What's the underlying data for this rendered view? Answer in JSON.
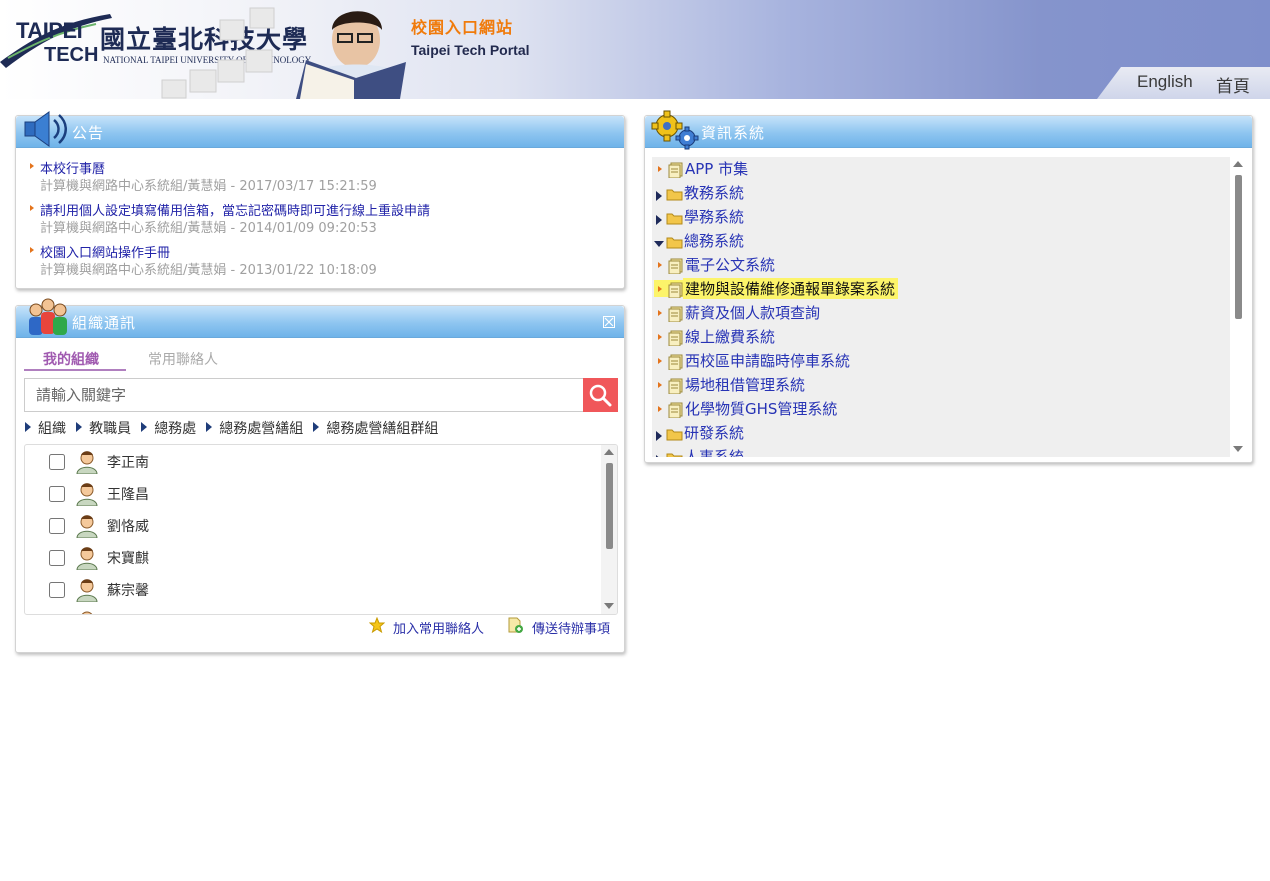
{
  "header": {
    "logo_word_top": "TAIPEI",
    "logo_word_bottom": "TECH",
    "logo_cn": "國立臺北科技大學",
    "logo_en": "NATIONAL TAIPEI UNIVERSITY OF TECHNOLOGY",
    "portal_cn": "校園入口網站",
    "portal_en": "Taipei Tech Portal",
    "nav": {
      "english": "English",
      "home": "首頁"
    }
  },
  "announcements": {
    "title": "公告",
    "items": [
      {
        "title": "本校行事曆",
        "meta": "計算機與網路中心系統組/黃慧娟 - 2017/03/17 15:21:59"
      },
      {
        "title": "請利用個人設定填寫備用信箱，當忘記密碼時即可進行線上重設申請",
        "meta": "計算機與網路中心系統組/黃慧娟 - 2014/01/09 09:20:53"
      },
      {
        "title": "校園入口網站操作手冊",
        "meta": "計算機與網路中心系統組/黃慧娟 - 2013/01/22 10:18:09"
      }
    ]
  },
  "org": {
    "title": "組織通訊",
    "tabs": {
      "mine": "我的組織",
      "common": "常用聯絡人"
    },
    "search_placeholder": "請輸入關鍵字",
    "breadcrumb": [
      "組織",
      "教職員",
      "總務處",
      "總務處營繕組",
      "總務處營繕組群組"
    ],
    "contacts": [
      "李正南",
      "王隆昌",
      "劉恪威",
      "宋寶麒",
      "蘇宗馨"
    ],
    "actions": {
      "add_common": "加入常用聯絡人",
      "send_todo": "傳送待辦事項"
    }
  },
  "systems": {
    "title": "資訊系統",
    "nodes": [
      {
        "label": "APP 市集"
      },
      {
        "label": "教務系統"
      },
      {
        "label": "學務系統"
      },
      {
        "label": "總務系統"
      },
      {
        "label": "電子公文系統"
      },
      {
        "label": "建物與設備維修通報單錄案系統"
      },
      {
        "label": "薪資及個人款項查詢"
      },
      {
        "label": "線上繳費系統"
      },
      {
        "label": "西校區申請臨時停車系統"
      },
      {
        "label": "場地租借管理系統"
      },
      {
        "label": "化學物質GHS管理系統"
      },
      {
        "label": "研發系統"
      },
      {
        "label": "人事系統"
      }
    ]
  },
  "colors": {
    "title_bar": "#8ec5f0",
    "link": "#2733b5",
    "highlight": "#fcf46a",
    "accent_orange": "#e4741c",
    "search_button": "#f0575a",
    "active_tab": "#a05ab0"
  }
}
